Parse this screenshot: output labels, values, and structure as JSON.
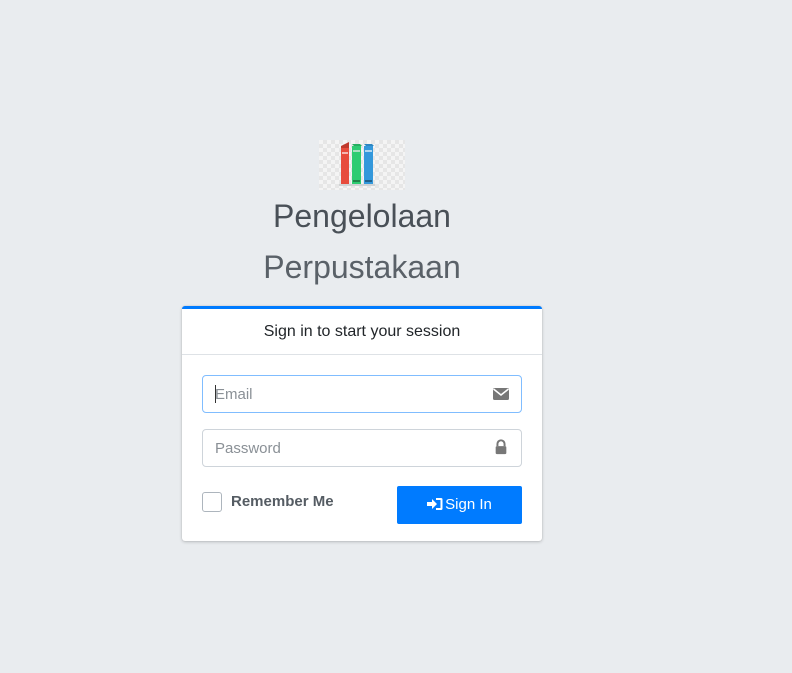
{
  "logo": {
    "icon": "books-icon",
    "colors": [
      "#e74c3c",
      "#2ecc71",
      "#3498db"
    ]
  },
  "header": {
    "title": "Pengelolaan",
    "subtitle": "Perpustakaan"
  },
  "login": {
    "message": "Sign in to start your session",
    "email": {
      "placeholder": "Email",
      "value": "",
      "icon": "envelope-icon"
    },
    "password": {
      "placeholder": "Password",
      "value": "",
      "icon": "lock-icon"
    },
    "remember": {
      "label": "Remember Me",
      "checked": false
    },
    "submit": {
      "label": "Sign In",
      "icon": "sign-in-icon"
    }
  },
  "colors": {
    "background": "#e9ecef",
    "accent": "#007bff",
    "card": "#ffffff"
  }
}
